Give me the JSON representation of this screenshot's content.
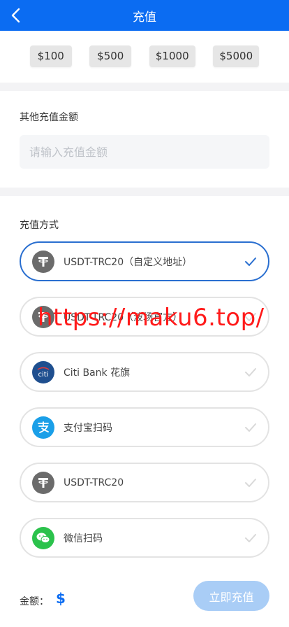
{
  "header": {
    "title": "充值"
  },
  "quick_amounts": [
    "$100",
    "$500",
    "$1000",
    "$5000"
  ],
  "other_amount": {
    "label": "其他充值金额",
    "placeholder": "请输入充值金额"
  },
  "payment": {
    "label": "充值方式",
    "methods": [
      {
        "label": "USDT-TRC20（自定义地址）",
        "icon": "tether-icon",
        "selected": true
      },
      {
        "label": "USDT-TRC20（波场官方）",
        "icon": "tether-icon",
        "selected": false
      },
      {
        "label": "Citi Bank 花旗",
        "icon": "citi-icon",
        "selected": false
      },
      {
        "label": "支付宝扫码",
        "icon": "alipay-icon",
        "selected": false
      },
      {
        "label": "USDT-TRC20",
        "icon": "tether-icon",
        "selected": false
      },
      {
        "label": "微信扫码",
        "icon": "wechat-icon",
        "selected": false
      }
    ]
  },
  "watermark": "https://maku6.top/",
  "footer": {
    "amount_label": "金额：",
    "currency": "$",
    "submit_label": "立即充值"
  },
  "colors": {
    "primary": "#0b6cf2",
    "submit_disabled": "#a9cdf6",
    "selected_border": "#2a6fd0"
  }
}
